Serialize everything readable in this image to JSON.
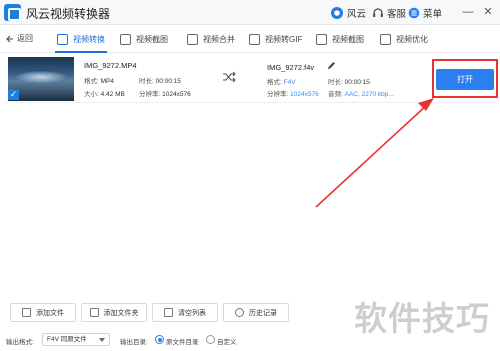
{
  "app": {
    "title": "风云视频转换器",
    "brand_label": "风云",
    "service_label": "客服",
    "menu_label": "菜单",
    "minimize": "—",
    "close": "✕"
  },
  "nav": {
    "back_label": "返回",
    "tabs": [
      {
        "label": "视频转换",
        "icon": "video-convert-icon"
      },
      {
        "label": "视频截图",
        "icon": "video-clip-icon"
      },
      {
        "label": "视频合并",
        "icon": "video-merge-icon"
      },
      {
        "label": "视频转GIF",
        "icon": "video-gif-icon"
      },
      {
        "label": "视频截图",
        "icon": "video-screenshot-icon"
      },
      {
        "label": "视频优化",
        "icon": "video-optimize-icon"
      }
    ]
  },
  "file": {
    "source": {
      "name": "IMG_9272.MP4",
      "format_label": "格式:",
      "format": "MP4",
      "duration_label": "时长:",
      "duration": "00:00:15",
      "size_label": "大小:",
      "size": "4.42 MB",
      "resolution_label": "分辨率:",
      "resolution": "1024x576"
    },
    "target": {
      "name": "IMG_9272.f4v",
      "format_label": "格式:",
      "format": "F4V",
      "duration_label": "时长:",
      "duration": "00:00:15",
      "resolution_label": "分辨率:",
      "resolution": "1024x576",
      "audio_label": "音频:",
      "audio": "AAC, 2270 kbp..."
    },
    "open_button": "打开"
  },
  "actions": {
    "add_file": "添加文件",
    "add_folder": "添加文件夹",
    "clear_list": "清空列表",
    "history": "历史记录"
  },
  "footer": {
    "output_format_label": "输出格式:",
    "output_format_value": "F4V 同原文件",
    "output_dir_label": "输出目录:",
    "radio_source": "原文件目录",
    "radio_custom": "自定义"
  },
  "watermark": "软件技巧",
  "colors": {
    "accent": "#2b7ff0",
    "highlight": "#e5332e"
  }
}
